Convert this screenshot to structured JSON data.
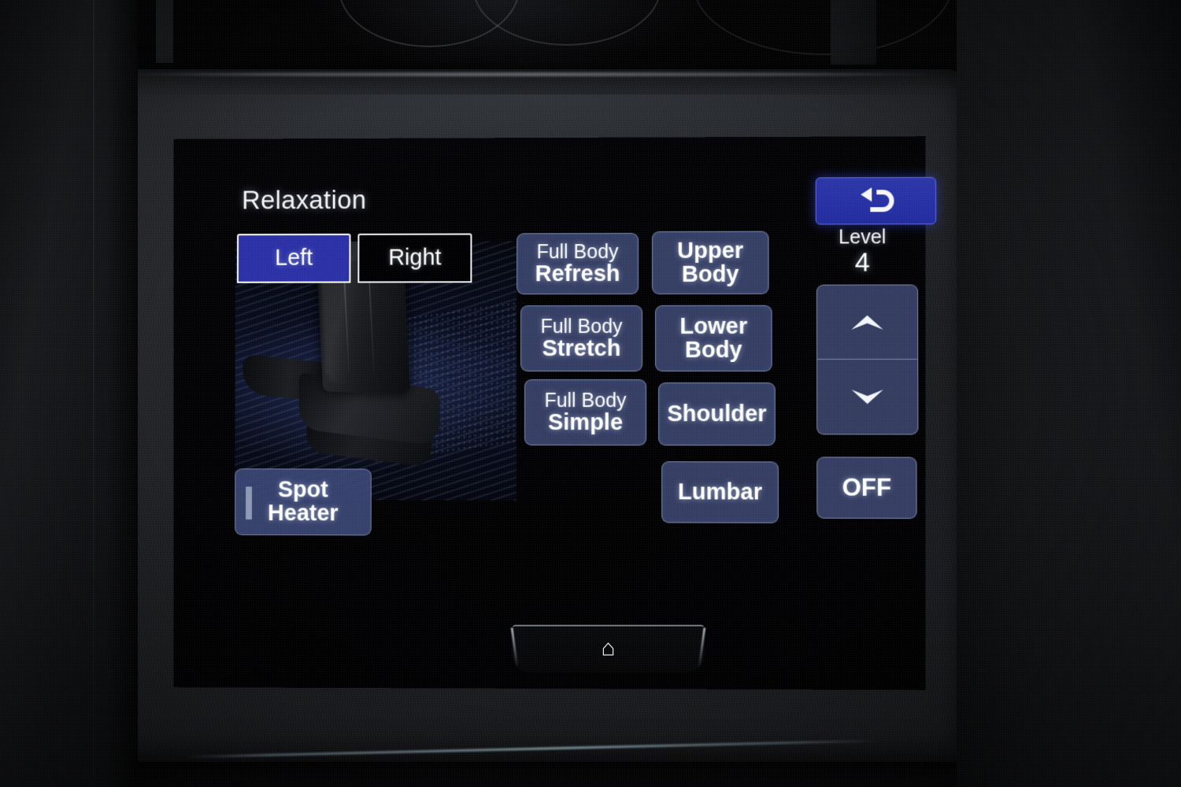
{
  "screen": {
    "title": "Relaxation",
    "back_button": {
      "name": "back-button",
      "glyph": "back-arrow-icon"
    },
    "tabs": [
      {
        "label": "Left",
        "active": true
      },
      {
        "label": "Right",
        "active": false
      }
    ],
    "seat_illustration": "car-seat-illustration",
    "program_buttons": [
      {
        "line1": "Full Body",
        "line2": "Refresh"
      },
      {
        "line1": "Full Body",
        "line2": "Stretch"
      },
      {
        "line1": "Full Body",
        "line2": "Simple"
      }
    ],
    "zone_buttons": [
      {
        "line1": "Upper",
        "line2": "Body"
      },
      {
        "line1": "Lower",
        "line2": "Body"
      },
      {
        "line1": "Shoulder"
      },
      {
        "line1": "Lumbar"
      }
    ],
    "level": {
      "label": "Level",
      "value": "4",
      "increase_icon": "chevron-up-icon",
      "decrease_icon": "chevron-down-icon"
    },
    "off_button": {
      "label": "OFF"
    },
    "spot_heater": {
      "line1": "Spot",
      "line2": "Heater",
      "indicator": "heat-level-bar"
    }
  },
  "hardware": {
    "home_button": {
      "name": "home-button",
      "glyph": "home-icon"
    }
  },
  "colors": {
    "accent_blue": "#2c31a6",
    "back_blue": "#242da0",
    "button_slate": "#424e7a",
    "text_white": "#ffffff",
    "screen_black": "#040406"
  }
}
